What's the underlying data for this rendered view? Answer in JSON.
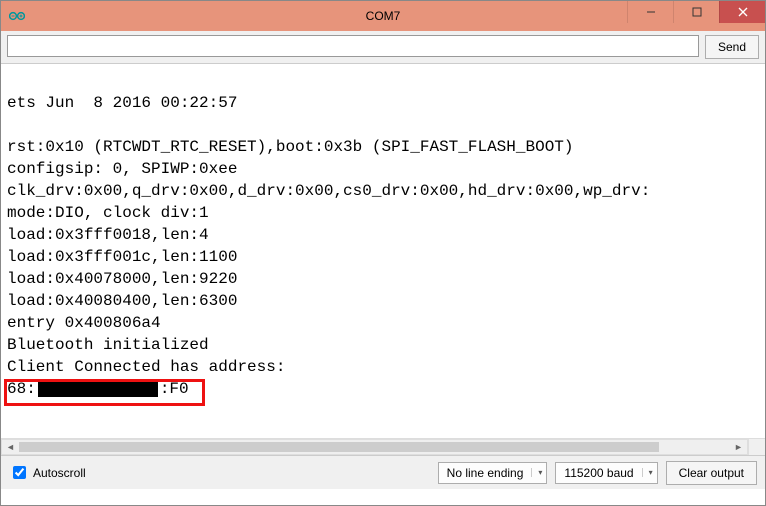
{
  "window": {
    "title": "COM7"
  },
  "input": {
    "value": "",
    "send_label": "Send"
  },
  "terminal": {
    "lines": [
      "ets Jun  8 2016 00:22:57",
      "",
      "rst:0x10 (RTCWDT_RTC_RESET),boot:0x3b (SPI_FAST_FLASH_BOOT)",
      "configsip: 0, SPIWP:0xee",
      "clk_drv:0x00,q_drv:0x00,d_drv:0x00,cs0_drv:0x00,hd_drv:0x00,wp_drv:",
      "mode:DIO, clock div:1",
      "load:0x3fff0018,len:4",
      "load:0x3fff001c,len:1100",
      "load:0x40078000,len:9220",
      "load:0x40080400,len:6300",
      "entry 0x400806a4",
      "Bluetooth initialized",
      "Client Connected has address:"
    ],
    "addr_line": {
      "prefix": "68:",
      "suffix": ":F0"
    }
  },
  "bottom": {
    "autoscroll_label": "Autoscroll",
    "autoscroll_checked": true,
    "line_ending": "No line ending",
    "baud": "115200 baud",
    "clear_label": "Clear output"
  }
}
